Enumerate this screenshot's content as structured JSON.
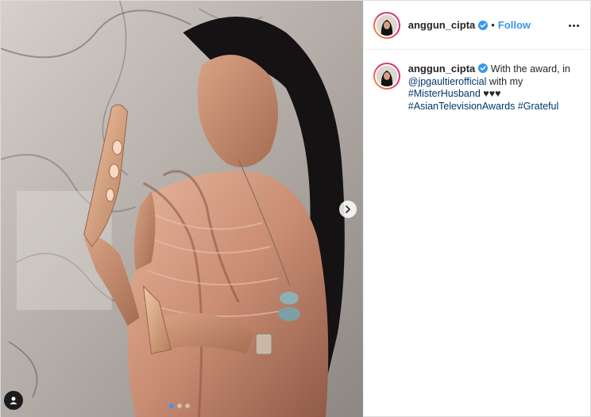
{
  "post": {
    "media": {
      "image_alt": "Woman in a pleated rose-gold dress holding an award",
      "carousel": {
        "total": 3,
        "active_index": 0
      }
    },
    "header": {
      "username": "anggun_cipta",
      "verified": true,
      "bullet": "•",
      "follow_label": "Follow"
    },
    "caption": {
      "username": "anggun_cipta",
      "text_1": "With the award, in",
      "mention": "@jpgaultierofficial",
      "text_2": "with my",
      "hashtag_1": "#MisterHusband",
      "hearts": "♥♥♥",
      "hashtag_2": "#AsianTelevisionAwards",
      "hashtag_3": "#Grateful"
    },
    "colors": {
      "accent": "#3897f0",
      "link": "#00376b",
      "text": "#262626"
    },
    "icons": {
      "next": "chevron-right-icon",
      "tag": "person-tag-icon",
      "verified": "verified-badge-icon",
      "more": "more-options-icon"
    }
  }
}
